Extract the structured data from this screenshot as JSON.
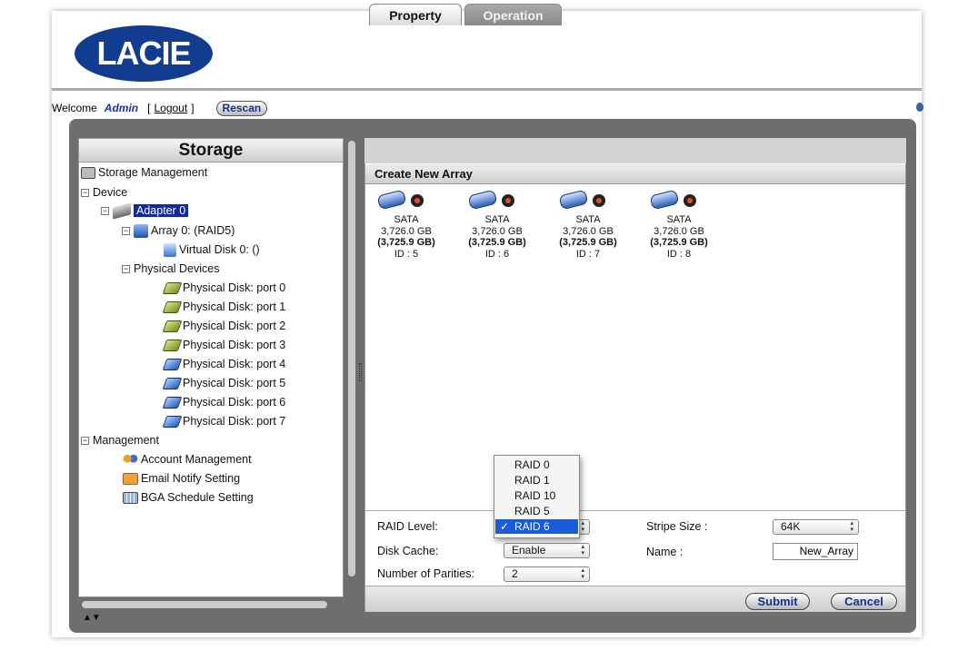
{
  "logo_text": "LACIE",
  "topbar": {
    "welcome": "Welcome",
    "user": "Admin",
    "bracket_open": "[",
    "logout": "Logout",
    "bracket_close": "]",
    "rescan": "Rescan"
  },
  "left_panel": {
    "title": "Storage",
    "tree": [
      {
        "label": "Storage Management"
      },
      {
        "label": "Device"
      },
      {
        "label": "Adapter 0"
      },
      {
        "label": "Array 0: (RAID5)"
      },
      {
        "label": "Virtual Disk 0: ()"
      },
      {
        "label": "Physical Devices"
      },
      {
        "label": "Physical Disk: port 0"
      },
      {
        "label": "Physical Disk: port 1"
      },
      {
        "label": "Physical Disk: port 2"
      },
      {
        "label": "Physical Disk: port 3"
      },
      {
        "label": "Physical Disk: port 4"
      },
      {
        "label": "Physical Disk: port 5"
      },
      {
        "label": "Physical Disk: port 6"
      },
      {
        "label": "Physical Disk: port 7"
      },
      {
        "label": "Management"
      },
      {
        "label": "Account Management"
      },
      {
        "label": "Email Notify Setting"
      },
      {
        "label": "BGA Schedule Setting"
      }
    ],
    "scroll_arrows": "▲▼"
  },
  "tabs": {
    "property": "Property",
    "operation": "Operation"
  },
  "section_title": "Create New Array",
  "disks": [
    {
      "type": "SATA",
      "size": "3,726.0 GB",
      "usable": "(3,725.9 GB)",
      "id": "ID : 5"
    },
    {
      "type": "SATA",
      "size": "3,726.0 GB",
      "usable": "(3,725.9 GB)",
      "id": "ID : 6"
    },
    {
      "type": "SATA",
      "size": "3,726.0 GB",
      "usable": "(3,725.9 GB)",
      "id": "ID : 7"
    },
    {
      "type": "SATA",
      "size": "3,726.0 GB",
      "usable": "(3,725.9 GB)",
      "id": "ID : 8"
    }
  ],
  "form": {
    "raid_level_label": "RAID Level:",
    "disk_cache_label": "Disk Cache:",
    "disk_cache_value": "Enable",
    "parities_label": "Number of Parities:",
    "parities_value": "2",
    "stripe_label": "Stripe Size :",
    "stripe_value": "64K",
    "name_label": "Name :",
    "name_value": "New_Array"
  },
  "raid_options": [
    {
      "label": "RAID 0",
      "selected": false
    },
    {
      "label": "RAID 1",
      "selected": false
    },
    {
      "label": "RAID 10",
      "selected": false
    },
    {
      "label": "RAID 5",
      "selected": false
    },
    {
      "label": "RAID 6",
      "selected": true,
      "check": "✓"
    }
  ],
  "buttons": {
    "submit": "Submit",
    "cancel": "Cancel"
  }
}
